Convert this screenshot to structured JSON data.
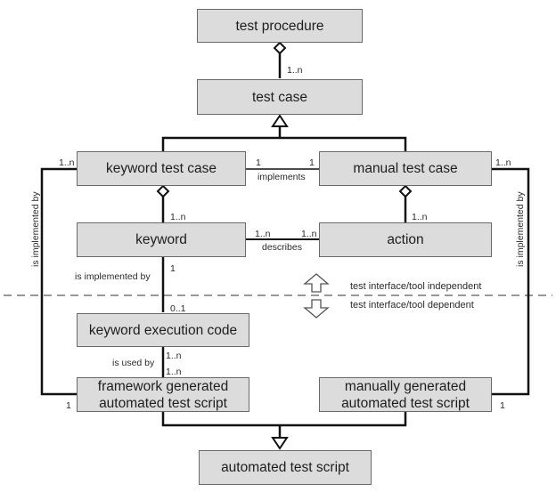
{
  "diagram": {
    "boxes": {
      "test_procedure": "test procedure",
      "test_case": "test case",
      "keyword_test_case": "keyword test case",
      "manual_test_case": "manual test case",
      "keyword": "keyword",
      "action": "action",
      "keyword_execution_code": "keyword execution code",
      "framework_script_line1": "framework generated",
      "framework_script_line2": "automated test script",
      "manual_script_line1": "manually generated",
      "manual_script_line2": "automated test script",
      "automated_test_script": "automated test script"
    },
    "relations": {
      "procedure_case_mult": "1..n",
      "implements": "implements",
      "implements_left_mult": "1",
      "implements_right_mult": "1",
      "ktc_keyword_mult": "1..n",
      "mtc_action_mult": "1..n",
      "describes": "describes",
      "describes_left_mult": "1..n",
      "describes_right_mult": "1..n",
      "kw_impl_label": "is implemented by",
      "kw_impl_top_mult": "1",
      "kw_impl_bottom_mult": "0..1",
      "used_by_label": "is used by",
      "used_by_top_mult": "1..n",
      "used_by_bottom_mult": "1..n",
      "left_impl_label": "is implemented by",
      "left_impl_top_mult": "1..n",
      "left_impl_bottom_mult": "1",
      "right_impl_label": "is implemented by",
      "right_impl_top_mult": "1..n",
      "right_impl_bottom_mult": "1"
    },
    "legend": {
      "independent": "test interface/tool independent",
      "dependent": "test interface/tool dependent"
    }
  }
}
